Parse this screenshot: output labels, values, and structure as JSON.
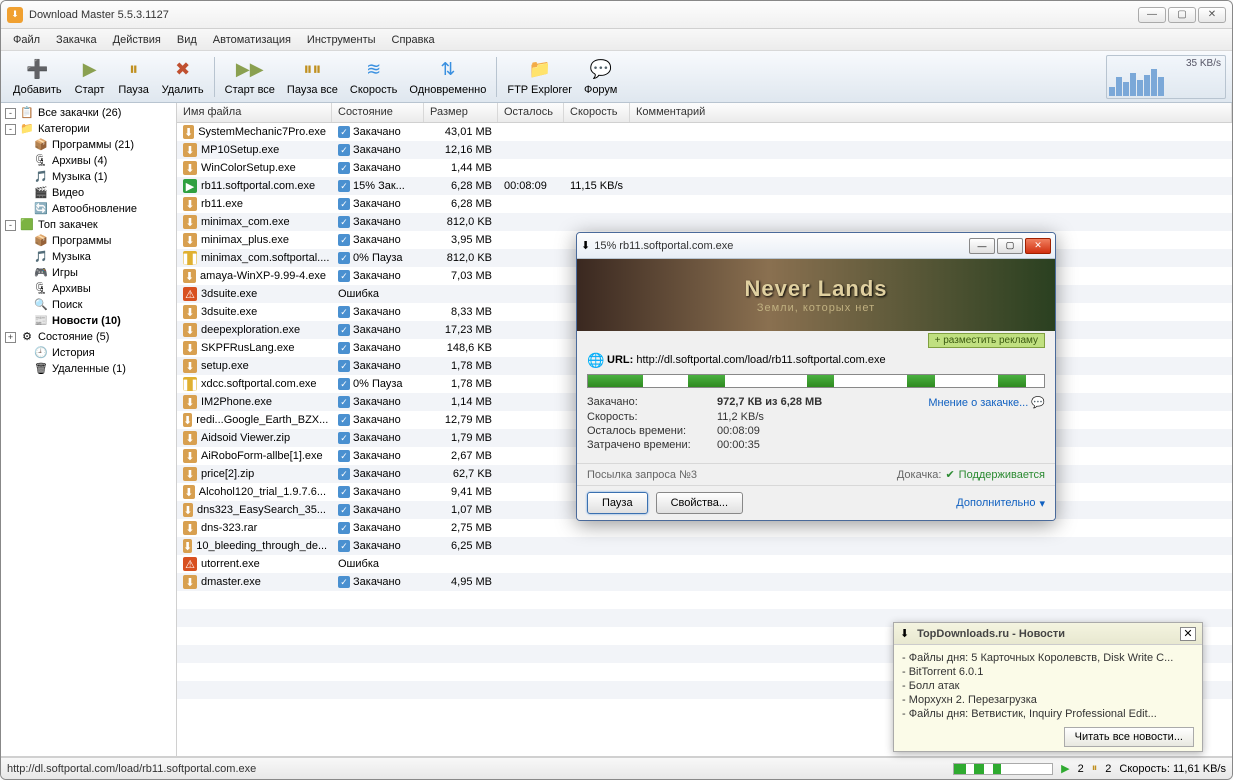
{
  "app": {
    "title": "Download Master 5.5.3.1127"
  },
  "menu": [
    "Файл",
    "Закачка",
    "Действия",
    "Вид",
    "Автоматизация",
    "Инструменты",
    "Справка"
  ],
  "toolbar": [
    {
      "label": "Добавить",
      "icon": "➕",
      "color": "#3a90e0"
    },
    {
      "label": "Старт",
      "icon": "▶",
      "color": "#8aa050"
    },
    {
      "label": "Пауза",
      "icon": "⏸",
      "color": "#c09020"
    },
    {
      "label": "Удалить",
      "icon": "✖",
      "color": "#c05030"
    },
    {
      "sep": true,
      "label": ""
    },
    {
      "label": "Старт все",
      "icon": "▶▶",
      "color": "#8aa050"
    },
    {
      "label": "Пауза все",
      "icon": "⏸⏸",
      "color": "#c09020"
    },
    {
      "label": "Скорость",
      "icon": "≋",
      "color": "#3a90e0"
    },
    {
      "label": "Одновременно",
      "icon": "⇅",
      "color": "#3a90e0"
    },
    {
      "sep": true,
      "label": ""
    },
    {
      "label": "FTP Explorer",
      "icon": "📁",
      "color": "#e0b030"
    },
    {
      "label": "Форум",
      "icon": "💬",
      "color": "#3ab0e0"
    }
  ],
  "speed_label": "35 KB/s",
  "tree": [
    {
      "exp": "-",
      "ico": "📋",
      "txt": "Все закачки (26)"
    },
    {
      "exp": "-",
      "ico": "📁",
      "txt": "Категории",
      "lvl": 0
    },
    {
      "ico": "📦",
      "txt": "Программы (21)",
      "lvl": 2
    },
    {
      "ico": "🗜",
      "txt": "Архивы (4)",
      "lvl": 2
    },
    {
      "ico": "🎵",
      "txt": "Музыка (1)",
      "lvl": 2
    },
    {
      "ico": "🎬",
      "txt": "Видео",
      "lvl": 2
    },
    {
      "ico": "🔄",
      "txt": "Автообновление",
      "lvl": 2
    },
    {
      "exp": "-",
      "ico": "🟩",
      "txt": "Топ закачек",
      "lvl": 0
    },
    {
      "ico": "📦",
      "txt": "Программы",
      "lvl": 2
    },
    {
      "ico": "🎵",
      "txt": "Музыка",
      "lvl": 2
    },
    {
      "ico": "🎮",
      "txt": "Игры",
      "lvl": 2
    },
    {
      "ico": "🗜",
      "txt": "Архивы",
      "lvl": 2
    },
    {
      "ico": "🔍",
      "txt": "Поиск",
      "lvl": 2
    },
    {
      "ico": "📰",
      "txt": "Новости (10)",
      "lvl": 2,
      "bold": true
    },
    {
      "exp": "+",
      "ico": "⚙",
      "txt": "Состояние (5)",
      "lvl": 0
    },
    {
      "ico": "🕘",
      "txt": "История",
      "lvl": 1
    },
    {
      "ico": "🗑",
      "txt": "Удаленные (1)",
      "lvl": 1
    }
  ],
  "columns": [
    "Имя файла",
    "Состояние",
    "Размер",
    "Осталось",
    "Скорость",
    "Комментарий"
  ],
  "rows": [
    {
      "i": "dl",
      "name": "SystemMechanic7Pro.exe",
      "s": "ok",
      "state": "Закачано",
      "size": "43,01 MB"
    },
    {
      "i": "dl",
      "name": "MP10Setup.exe",
      "s": "ok",
      "state": "Закачано",
      "size": "12,16 MB"
    },
    {
      "i": "dl",
      "name": "WinColorSetup.exe",
      "s": "ok",
      "state": "Закачано",
      "size": "1,44 MB"
    },
    {
      "i": "play",
      "name": "rb11.softportal.com.exe",
      "s": "ok",
      "state": "15% Зак...",
      "size": "6,28 MB",
      "left": "00:08:09",
      "spd": "11,15 KB/s"
    },
    {
      "i": "dl",
      "name": "rb11.exe",
      "s": "ok",
      "state": "Закачано",
      "size": "6,28 MB"
    },
    {
      "i": "dl",
      "name": "minimax_com.exe",
      "s": "ok",
      "state": "Закачано",
      "size": "812,0 KB"
    },
    {
      "i": "dl",
      "name": "minimax_plus.exe",
      "s": "ok",
      "state": "Закачано",
      "size": "3,95 MB"
    },
    {
      "i": "pause",
      "name": "minimax_com.softportal....",
      "s": "ok",
      "state": "0% Пауза",
      "size": "812,0 KB"
    },
    {
      "i": "dl",
      "name": "amaya-WinXP-9.99-4.exe",
      "s": "ok",
      "state": "Закачано",
      "size": "7,03 MB"
    },
    {
      "i": "err",
      "name": "3dsuite.exe",
      "s": "err",
      "state": "Ошибка",
      "size": ""
    },
    {
      "i": "dl",
      "name": "3dsuite.exe",
      "s": "ok",
      "state": "Закачано",
      "size": "8,33 MB"
    },
    {
      "i": "dl",
      "name": "deepexploration.exe",
      "s": "ok",
      "state": "Закачано",
      "size": "17,23 MB"
    },
    {
      "i": "dl",
      "name": "SKPFRusLang.exe",
      "s": "ok",
      "state": "Закачано",
      "size": "148,6 KB"
    },
    {
      "i": "dl",
      "name": "setup.exe",
      "s": "ok",
      "state": "Закачано",
      "size": "1,78 MB"
    },
    {
      "i": "pause",
      "name": "xdcc.softportal.com.exe",
      "s": "ok",
      "state": "0% Пауза",
      "size": "1,78 MB"
    },
    {
      "i": "dl",
      "name": "IM2Phone.exe",
      "s": "ok",
      "state": "Закачано",
      "size": "1,14 MB"
    },
    {
      "i": "dl",
      "name": "redi...Google_Earth_BZX...",
      "s": "ok",
      "state": "Закачано",
      "size": "12,79 MB"
    },
    {
      "i": "dl",
      "name": "Aidsoid Viewer.zip",
      "s": "ok",
      "state": "Закачано",
      "size": "1,79 MB"
    },
    {
      "i": "dl",
      "name": "AiRoboForm-allbe[1].exe",
      "s": "ok",
      "state": "Закачано",
      "size": "2,67 MB"
    },
    {
      "i": "dl",
      "name": "price[2].zip",
      "s": "ok",
      "state": "Закачано",
      "size": "62,7 KB"
    },
    {
      "i": "dl",
      "name": "Alcohol120_trial_1.9.7.6...",
      "s": "ok",
      "state": "Закачано",
      "size": "9,41 MB"
    },
    {
      "i": "dl",
      "name": "dns323_EasySearch_35...",
      "s": "ok",
      "state": "Закачано",
      "size": "1,07 MB"
    },
    {
      "i": "dl",
      "name": "dns-323.rar",
      "s": "ok",
      "state": "Закачано",
      "size": "2,75 MB"
    },
    {
      "i": "dl",
      "name": "10_bleeding_through_de...",
      "s": "ok",
      "state": "Закачано",
      "size": "6,25 MB"
    },
    {
      "i": "err",
      "name": "utorrent.exe",
      "s": "err",
      "state": "Ошибка",
      "size": ""
    },
    {
      "i": "dl",
      "name": "dmaster.exe",
      "s": "ok",
      "state": "Закачано",
      "size": "4,95 MB"
    }
  ],
  "status": {
    "url": "http://dl.softportal.com/load/rb11.softportal.com.exe",
    "count": "2",
    "speed": "Скорость: 11,61 KB/s"
  },
  "dlg": {
    "title": "15% rb11.softportal.com.exe",
    "banner_big": "Never Lands",
    "banner_small": "Земли, которых нет",
    "ad": "+ разместить рекламу",
    "url_lbl": "URL:",
    "url": "http://dl.softportal.com/load/rb11.softportal.com.exe",
    "done_lbl": "Закачано:",
    "done_val": "972,7 КВ из 6,28 МВ",
    "spd_lbl": "Скорость:",
    "spd_val": "11,2 KB/s",
    "left_lbl": "Осталось времени:",
    "left_val": "00:08:09",
    "elap_lbl": "Затрачено времени:",
    "elap_val": "00:00:35",
    "opinion": "Мнение о закачке...",
    "req": "Посылка запроса №3",
    "resume_lbl": "Докачка:",
    "resume_val": "Поддерживается",
    "pause": "Пауза",
    "props": "Свойства...",
    "more": "Дополнительно"
  },
  "news": {
    "title": "TopDownloads.ru - Новости",
    "items": [
      "- Файлы дня: 5 Карточных Королевств, Disk Write C...",
      "- BitTorrent 6.0.1",
      "- Болл атак",
      "- Морхухн 2. Перезагрузка",
      "- Файлы дня: Ветвистик, Inquiry Professional Edit..."
    ],
    "read_all": "Читать все новости..."
  }
}
